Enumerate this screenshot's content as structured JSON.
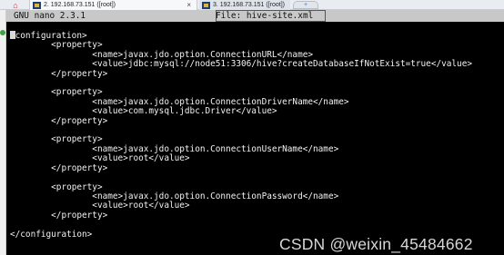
{
  "browser_tabs": {
    "tab1": "2. 192.168.73.151 ([root])",
    "tab1_close": "×",
    "tab2": "3. 192.168.73.151 ([root])",
    "new_tab": "+"
  },
  "nano": {
    "version": "GNU nano 2.3.1",
    "file_label": "File: hive-site.xml"
  },
  "editor_lines": [
    "configuration>",
    "        <property>",
    "                <name>javax.jdo.option.ConnectionURL</name>",
    "                <value>jdbc:mysql://node51:3306/hive?createDatabaseIfNotExist=true</value>",
    "        </property>",
    "",
    "        <property>",
    "                <name>javax.jdo.option.ConnectionDriverName</name>",
    "                <value>com.mysql.jdbc.Driver</value>",
    "        </property>",
    "",
    "        <property>",
    "                <name>javax.jdo.option.ConnectionUserName</name>",
    "                <value>root</value>",
    "        </property>",
    "",
    "        <property>",
    "                <name>javax.jdo.option.ConnectionPassword</name>",
    "                <value>root</value>",
    "        </property>",
    "",
    "</configuration>"
  ],
  "watermark": "CSDN @weixin_45484662",
  "colors": {
    "terminal_bg": "#000000",
    "text": "#f2f2f2",
    "header_bg": "#c8c8c8",
    "highlight_box": "#e11b1b"
  },
  "icons": {
    "home": "home-icon",
    "terminal_tab": "terminal-icon"
  }
}
